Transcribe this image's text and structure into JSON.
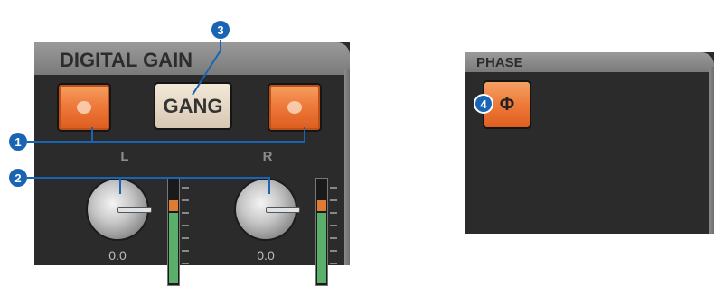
{
  "digital_gain": {
    "title": "DIGITAL GAIN",
    "gang_label": "GANG",
    "left_label": "L",
    "right_label": "R",
    "left_value": "0.0",
    "right_value": "0.0"
  },
  "phase": {
    "title": "PHASE",
    "button_label": "Φ"
  },
  "callouts": [
    "1",
    "2",
    "3",
    "4"
  ],
  "colors": {
    "callout": "#1a64b4",
    "button_orange": "#ee7a3c",
    "panel_bg": "#2b2b2b"
  }
}
